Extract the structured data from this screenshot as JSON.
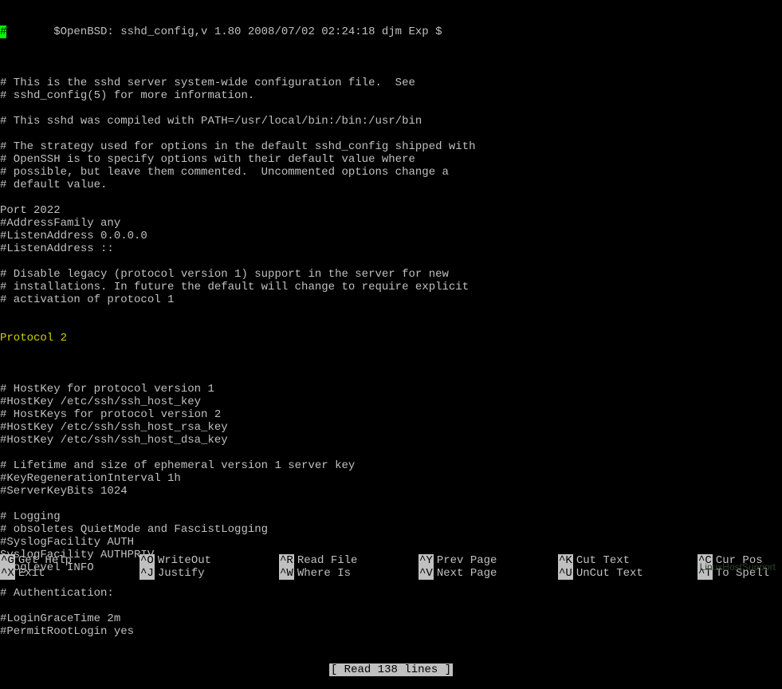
{
  "header_prefix": "#",
  "header_text": "       $OpenBSD: sshd_config,v 1.80 2008/07/02 02:24:18 djm Exp $",
  "lines": [
    "",
    "# This is the sshd server system-wide configuration file.  See",
    "# sshd_config(5) for more information.",
    "",
    "# This sshd was compiled with PATH=/usr/local/bin:/bin:/usr/bin",
    "",
    "# The strategy used for options in the default sshd_config shipped with",
    "# OpenSSH is to specify options with their default value where",
    "# possible, but leave them commented.  Uncommented options change a",
    "# default value.",
    "",
    "Port 2022",
    "#AddressFamily any",
    "#ListenAddress 0.0.0.0",
    "#ListenAddress ::",
    "",
    "# Disable legacy (protocol version 1) support in the server for new",
    "# installations. In future the default will change to require explicit",
    "# activation of protocol 1"
  ],
  "highlighted_line": "Protocol 2",
  "lines_after": [
    "",
    "# HostKey for protocol version 1",
    "#HostKey /etc/ssh/ssh_host_key",
    "# HostKeys for protocol version 2",
    "#HostKey /etc/ssh/ssh_host_rsa_key",
    "#HostKey /etc/ssh/ssh_host_dsa_key",
    "",
    "# Lifetime and size of ephemeral version 1 server key",
    "#KeyRegenerationInterval 1h",
    "#ServerKeyBits 1024",
    "",
    "# Logging",
    "# obsoletes QuietMode and FascistLogging",
    "#SyslogFacility AUTH",
    "SyslogFacility AUTHPRIV",
    "#LogLevel INFO",
    "",
    "# Authentication:",
    "",
    "#LoginGraceTime 2m",
    "#PermitRootLogin yes"
  ],
  "status": "[ Read 138 lines ]",
  "shortcuts": {
    "row1": [
      {
        "key": "^G",
        "label": "Get Help"
      },
      {
        "key": "^O",
        "label": "WriteOut"
      },
      {
        "key": "^R",
        "label": "Read File"
      },
      {
        "key": "^Y",
        "label": "Prev Page"
      },
      {
        "key": "^K",
        "label": "Cut Text"
      },
      {
        "key": "^C",
        "label": "Cur Pos"
      }
    ],
    "row2": [
      {
        "key": "^X",
        "label": "Exit"
      },
      {
        "key": "^J",
        "label": "Justify"
      },
      {
        "key": "^W",
        "label": "Where Is"
      },
      {
        "key": "^V",
        "label": "Next Page"
      },
      {
        "key": "^U",
        "label": "UnCut Text"
      },
      {
        "key": "^T",
        "label": "To Spell"
      }
    ]
  },
  "watermark": "LinuxHostSupport"
}
